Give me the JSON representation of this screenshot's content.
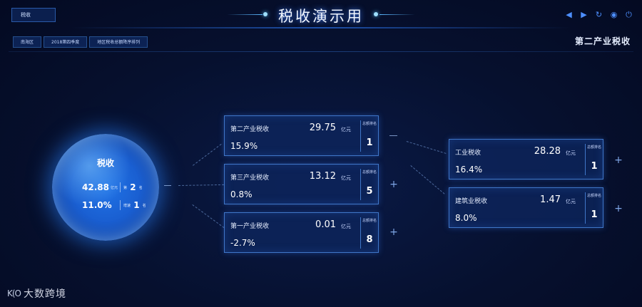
{
  "header": {
    "button_label": "税收",
    "title": "税收演示用",
    "controls": [
      {
        "icon": "prev-icon",
        "glyph": "◀"
      },
      {
        "icon": "play-icon",
        "glyph": "▶"
      },
      {
        "icon": "refresh-icon",
        "glyph": "↻"
      },
      {
        "icon": "eye-icon",
        "glyph": "◉"
      },
      {
        "icon": "power-icon",
        "glyph": "⏻"
      }
    ]
  },
  "filters": [
    "南海区",
    "2018第四季度",
    "地区税收总额降序排列"
  ],
  "section_title": "第二产业税收",
  "orb": {
    "title": "税收",
    "amount": "42.88",
    "amount_unit": "亿元",
    "rank_prefix": "第",
    "rank": "2",
    "rank_suffix": "名",
    "growth": "11.0%",
    "growth_label": "增速",
    "growth_rank": "1",
    "growth_rank_suffix": "名"
  },
  "rank_label": "总额排名",
  "level1": [
    {
      "name": "第二产业税收",
      "value": "29.75",
      "unit": "亿元",
      "pct": "15.9%",
      "rank": "1"
    },
    {
      "name": "第三产业税收",
      "value": "13.12",
      "unit": "亿元",
      "pct": "0.8%",
      "rank": "5"
    },
    {
      "name": "第一产业税收",
      "value": "0.01",
      "unit": "亿元",
      "pct": "-2.7%",
      "rank": "8"
    }
  ],
  "level2": [
    {
      "name": "工业税收",
      "value": "28.28",
      "unit": "亿元",
      "pct": "16.4%",
      "rank": "1"
    },
    {
      "name": "建筑业税收",
      "value": "1.47",
      "unit": "亿元",
      "pct": "8.0%",
      "rank": "1"
    }
  ],
  "logo": {
    "mark": "K(O",
    "text": "大数跨境"
  },
  "colors": {
    "accent": "#3f76c8",
    "background": "#06102e",
    "orb": "#1f72e6"
  }
}
